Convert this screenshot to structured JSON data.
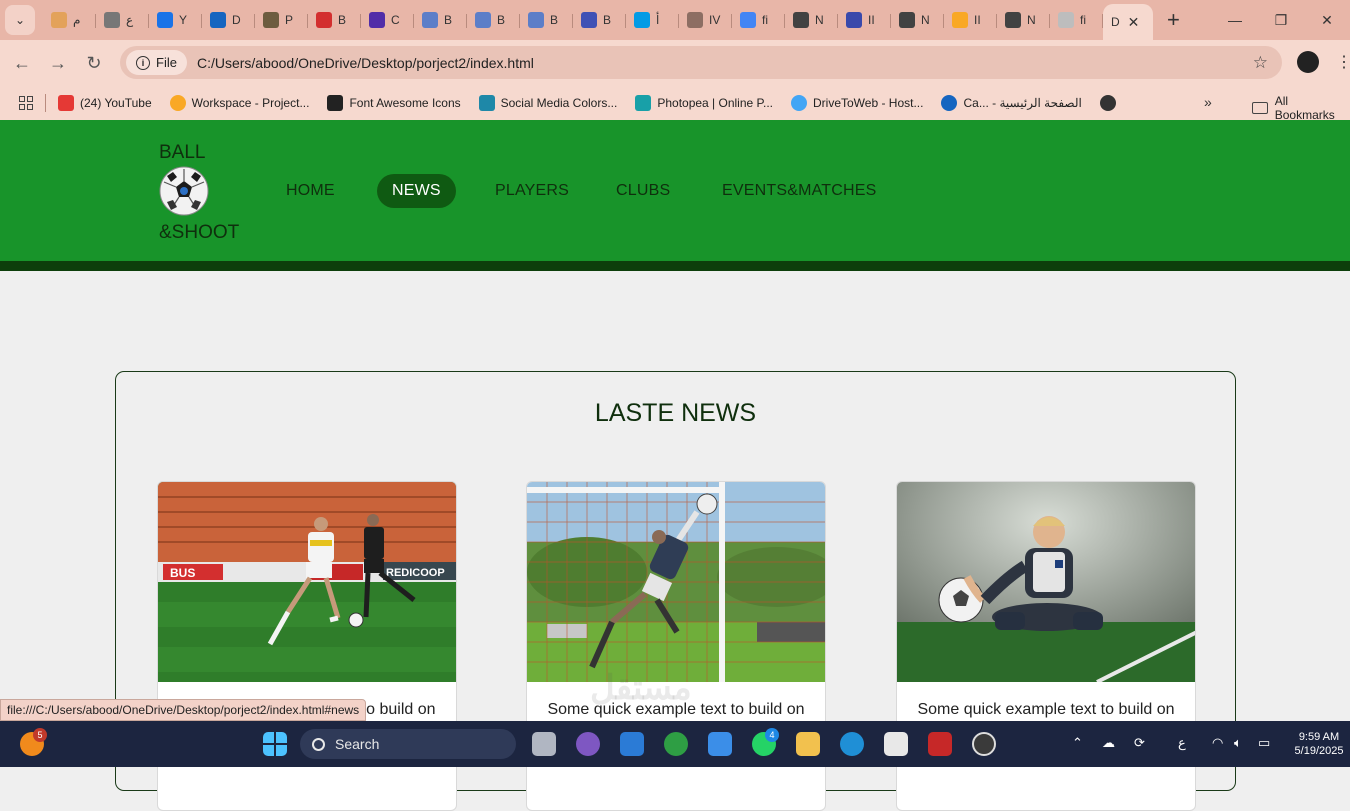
{
  "browser": {
    "tabs": [
      {
        "label": "م",
        "color": "#e3a25b"
      },
      {
        "label": "ع",
        "color": "#777777"
      },
      {
        "label": "Y",
        "color": "#1a73e8"
      },
      {
        "label": "D",
        "color": "#1565c0"
      },
      {
        "label": "P",
        "color": "#6d5c3f"
      },
      {
        "label": "B",
        "color": "#d32f2f"
      },
      {
        "label": "C",
        "color": "#512da8"
      },
      {
        "label": "B",
        "color": "#5c7ec8"
      },
      {
        "label": "B",
        "color": "#5c7ec8"
      },
      {
        "label": "B",
        "color": "#5c7ec8"
      },
      {
        "label": "B",
        "color": "#3f51b5"
      },
      {
        "label": "أ",
        "color": "#039be5"
      },
      {
        "label": "IV",
        "color": "#8d6e63"
      },
      {
        "label": "fi",
        "color": "#4285f4"
      },
      {
        "label": "N",
        "color": "#424242"
      },
      {
        "label": "II",
        "color": "#3949ab"
      },
      {
        "label": "N",
        "color": "#424242"
      },
      {
        "label": "II",
        "color": "#f9a825"
      },
      {
        "label": "N",
        "color": "#424242"
      },
      {
        "label": "fi",
        "color": "#bdbdbd"
      }
    ],
    "active_tab": {
      "label": "D",
      "close": "✕"
    },
    "new_tab": "+",
    "window_controls": {
      "minimize": "—",
      "maximize": "❐",
      "close": "✕"
    },
    "nav": {
      "back": "←",
      "forward": "→",
      "reload": "↻"
    },
    "site_chip": "File",
    "url": "C:/Users/abood/OneDrive/Desktop/porject2/index.html",
    "star": "☆",
    "menu": "⋮",
    "bookmarks": [
      {
        "label": "(24) YouTube",
        "color": "#e53935"
      },
      {
        "label": "Workspace - Project...",
        "color": "#f9a825"
      },
      {
        "label": "Font Awesome Icons",
        "color": "#222222"
      },
      {
        "label": "Social Media Colors...",
        "color": "#1e88a8"
      },
      {
        "label": "Photopea | Online P...",
        "color": "#18a0a8"
      },
      {
        "label": "DriveToWeb - Host...",
        "color": "#42a5f5"
      },
      {
        "label": "Ca... - الصفحة الرئيسية",
        "color": "#1565c0"
      },
      {
        "label": "",
        "color": "#333333"
      }
    ],
    "bookmarks_more": "»",
    "all_bookmarks": "All Bookmarks",
    "status_url": "file:///C:/Users/abood/OneDrive/Desktop/porject2/index.html#news"
  },
  "site": {
    "logo_top": "BALL",
    "logo_bottom": "&SHOOT",
    "nav": [
      "HOME",
      "NEWS",
      "PLAYERS",
      "CLUBS",
      "EVENTS&MATCHES"
    ],
    "active_nav": "NEWS",
    "header_color": "#18942a",
    "accent_dark": "#0f5a12",
    "news": {
      "title": "LASTE NEWS",
      "cards": [
        {
          "text": "Some quick example text to build on",
          "image": "player-dribbling-photo"
        },
        {
          "text": "Some quick example text to build on",
          "image": "goalkeeper-diving-photo"
        },
        {
          "text": "Some quick example text to build on",
          "image": "player-sitting-with-ball-photo"
        }
      ]
    }
  },
  "taskbar": {
    "search": "Search",
    "notification_count": "5",
    "whatsapp_count": "4",
    "lang": "ع",
    "time": "9:59 AM",
    "date": "5/19/2025"
  },
  "watermark": "مستقل"
}
